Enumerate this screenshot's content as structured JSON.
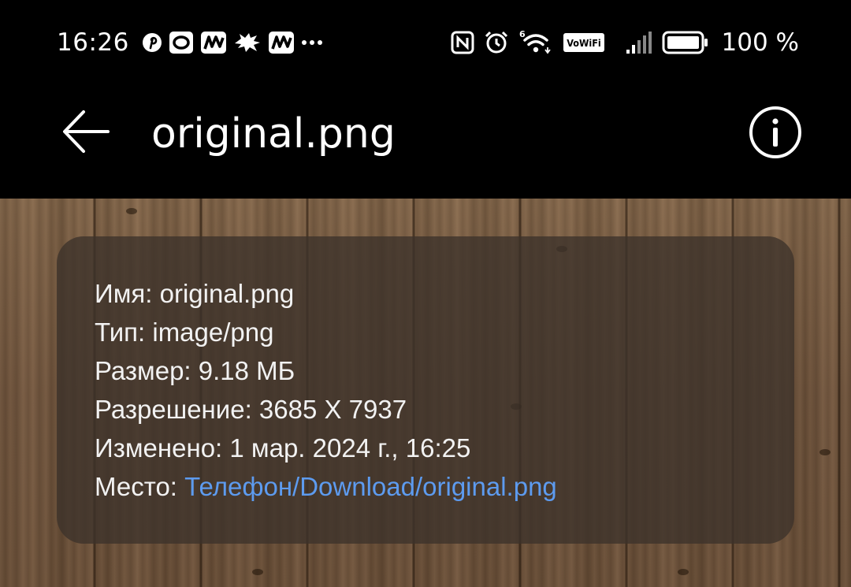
{
  "status_bar": {
    "time": "16:26",
    "battery_percent": "100 %",
    "notification_icons": [
      "pinterest-icon",
      "app-o-icon",
      "m-app-icon",
      "dragon-app-icon",
      "m-app-icon",
      "more-dots-icon"
    ],
    "system_icons": [
      "nfc-icon",
      "alarm-icon",
      "wifi-6-icon",
      "vowifi-icon",
      "signal-icon",
      "battery-icon"
    ],
    "vowifi_label": "VoWiFi",
    "wifi_label": "6"
  },
  "app_bar": {
    "title": "original.png"
  },
  "details": {
    "name_label": "Имя:",
    "name_value": "original.png",
    "type_label": "Тип:",
    "type_value": "image/png",
    "size_label": "Размер:",
    "size_value": "9.18 МБ",
    "resolution_label": "Разрешение:",
    "resolution_value": "3685 X 7937",
    "modified_label": "Изменено:",
    "modified_value": "1 мар. 2024 г., 16:25",
    "location_label": "Место:",
    "location_value": "Телефон/Download/original.png"
  },
  "colors": {
    "link": "#5d9bef",
    "panel": "#3c322a",
    "background": "#000000",
    "wood": "#7a5f45"
  }
}
